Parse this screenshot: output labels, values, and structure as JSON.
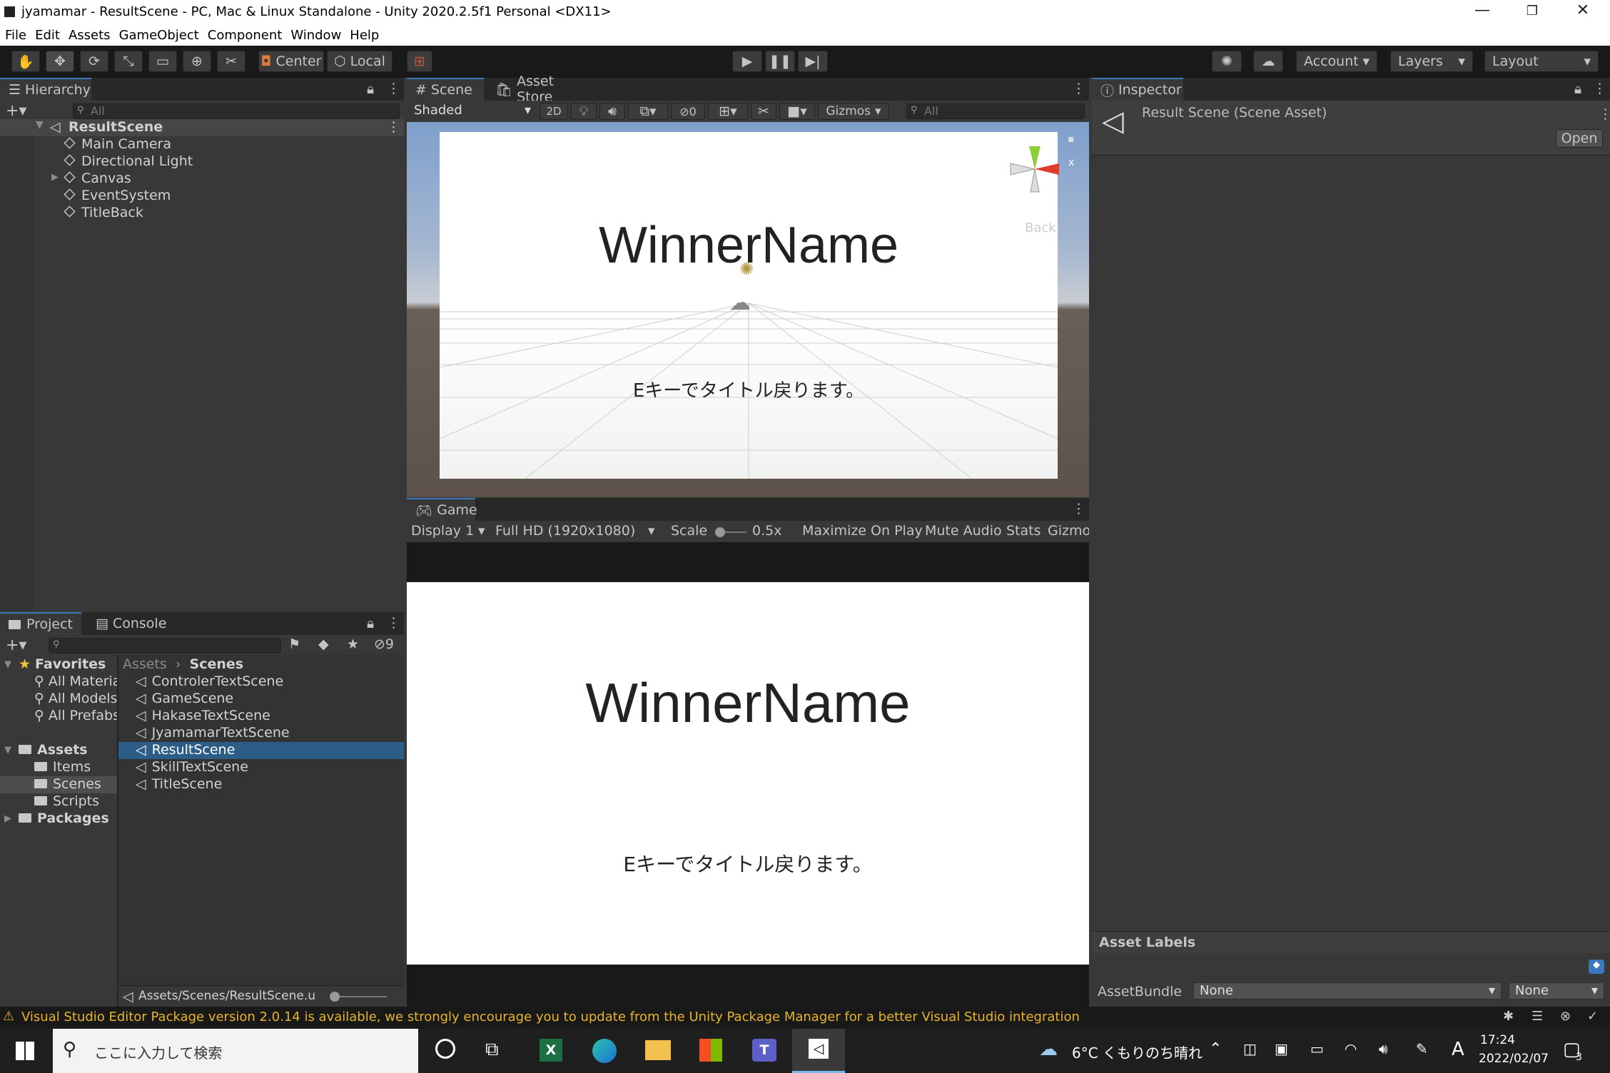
{
  "window": {
    "title": "jyamamar - ResultScene - PC, Mac & Linux Standalone - Unity 2020.2.5f1 Personal <DX11>"
  },
  "menu": [
    "File",
    "Edit",
    "Assets",
    "GameObject",
    "Component",
    "Window",
    "Help"
  ],
  "toolbar": {
    "center_label": "Center",
    "local_label": "Local",
    "account_label": "Account",
    "layers_label": "Layers",
    "layout_label": "Layout"
  },
  "hierarchy": {
    "tab": "Hierarchy",
    "search_placeholder": "All",
    "scene_name": "ResultScene",
    "items": [
      "Main Camera",
      "Directional Light",
      "Canvas",
      "EventSystem",
      "TitleBack"
    ]
  },
  "scene_view": {
    "tab_scene": "Scene",
    "tab_asset_store": "Asset Store",
    "shading": "Shaded",
    "mode_2d": "2D",
    "hidden_count": "0",
    "gizmos_label": "Gizmos",
    "search_placeholder": "All",
    "gizmo_back": "Back",
    "gizmo_x": "x",
    "winner_text": "WinnerName",
    "hint_text": "Eキーでタイトル戻ります。"
  },
  "game_view": {
    "tab": "Game",
    "display": "Display 1",
    "resolution": "Full HD (1920x1080)",
    "scale_label": "Scale",
    "scale_value": "0.5x",
    "maximize_on_play": "Maximize On Play",
    "mute_audio": "Mute Audio",
    "stats": "Stats",
    "gizmos": "Gizmos",
    "winner_text": "WinnerName",
    "hint_text": "Eキーでタイトル戻ります。"
  },
  "inspector": {
    "tab": "Inspector",
    "asset_title": "Result Scene (Scene Asset)",
    "open_button": "Open",
    "asset_labels": "Asset Labels",
    "asset_bundle_label": "AssetBundle",
    "bundle_value": "None",
    "variant_value": "None"
  },
  "project": {
    "tab_project": "Project",
    "tab_console": "Console",
    "hidden_count": "9",
    "favorites_label": "Favorites",
    "favorites": [
      "All Materia",
      "All Models",
      "All Prefabs"
    ],
    "assets_label": "Assets",
    "asset_folders": [
      "Items",
      "Scenes",
      "Scripts"
    ],
    "packages_label": "Packages",
    "breadcrumb_root": "Assets",
    "breadcrumb_current": "Scenes",
    "files": [
      "ControlerTextScene",
      "GameScene",
      "HakaseTextScene",
      "JyamamarTextScene",
      "ResultScene",
      "SkillTextScene",
      "TitleScene"
    ],
    "selected_file": "ResultScene",
    "footer_path": "Assets/Scenes/ResultScene.u"
  },
  "status": {
    "message": "Visual Studio Editor Package version 2.0.14 is available, we strongly encourage you to update from the Unity Package Manager for a better Visual Studio integration"
  },
  "taskbar": {
    "search_placeholder": "ここに入力して検索",
    "weather": "6°C くもりのち晴れ",
    "ime": "A",
    "time": "17:24",
    "date": "2022/02/07",
    "notifications": "3"
  },
  "colors": {
    "accent": "#3a79bb",
    "selection": "#2c5d87",
    "warning": "#e6b42b",
    "panel": "#383838"
  }
}
